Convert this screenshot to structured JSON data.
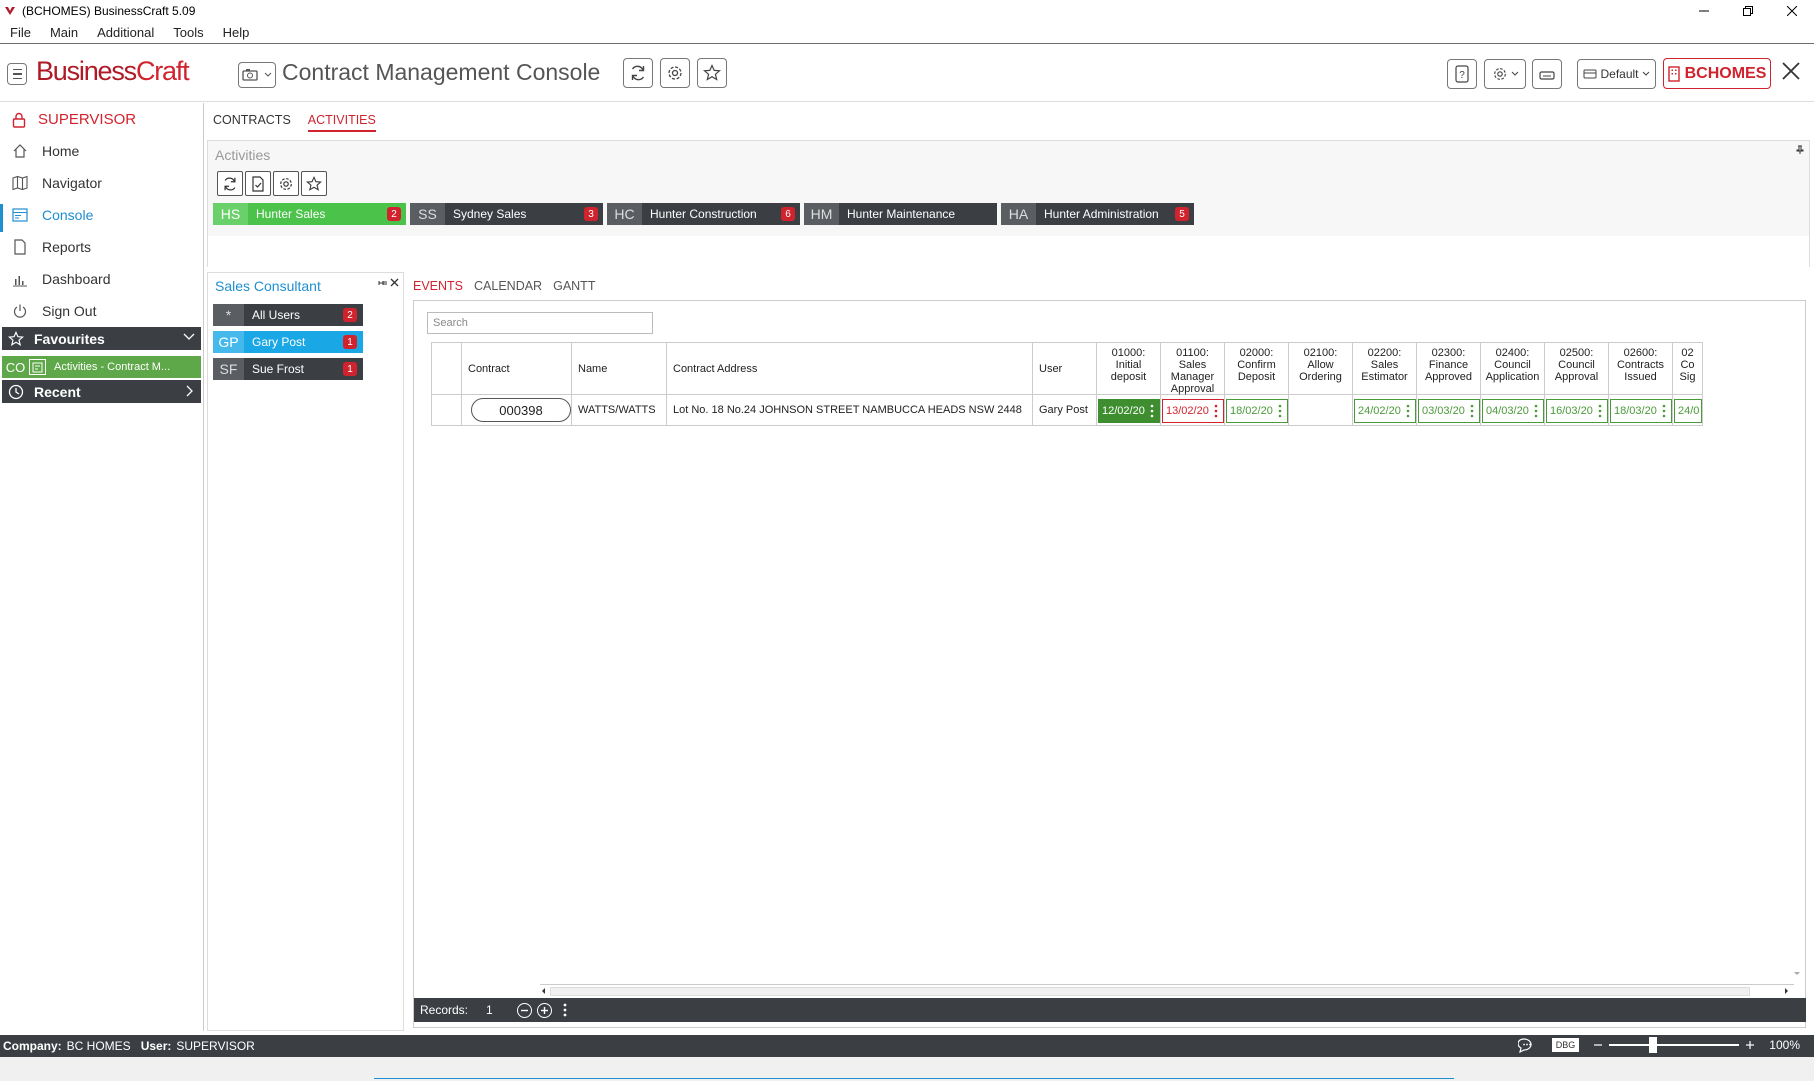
{
  "window": {
    "title": "(BCHOMES) BusinessCraft  5.09"
  },
  "menu": [
    "File",
    "Main",
    "Additional",
    "Tools",
    "Help"
  ],
  "header": {
    "brand_a": "Business",
    "brand_b": "Craft",
    "console_title": "Contract Management Console",
    "profile_label": "Default",
    "company_button": "BCHOMES"
  },
  "sidebar": {
    "user": "SUPERVISOR",
    "items": [
      {
        "label": "Home",
        "icon": "home-icon"
      },
      {
        "label": "Navigator",
        "icon": "map-icon"
      },
      {
        "label": "Console",
        "icon": "console-icon"
      },
      {
        "label": "Reports",
        "icon": "document-icon"
      },
      {
        "label": "Dashboard",
        "icon": "chart-icon"
      },
      {
        "label": "Sign Out",
        "icon": "power-icon"
      }
    ],
    "favourites_label": "Favourites",
    "favourite_item": {
      "code": "CO",
      "label": "Activities - Contract M..."
    },
    "recent_label": "Recent"
  },
  "main_tabs": [
    "CONTRACTS",
    "ACTIVITIES"
  ],
  "activities": {
    "title": "Activities",
    "teams": [
      {
        "code": "HS",
        "name": "Hunter Sales",
        "count": "2"
      },
      {
        "code": "SS",
        "name": "Sydney Sales",
        "count": "3"
      },
      {
        "code": "HC",
        "name": "Hunter Construction",
        "count": "6"
      },
      {
        "code": "HM",
        "name": "Hunter Maintenance",
        "count": ""
      },
      {
        "code": "HA",
        "name": "Hunter Administration",
        "count": "5"
      }
    ]
  },
  "sales_consultant": {
    "title": "Sales Consultant",
    "users": [
      {
        "code": "*",
        "name": "All Users",
        "count": "2"
      },
      {
        "code": "GP",
        "name": "Gary Post",
        "count": "1"
      },
      {
        "code": "SF",
        "name": "Sue Frost",
        "count": "1"
      }
    ]
  },
  "event_tabs": [
    "EVENTS",
    "CALENDAR",
    "GANTT"
  ],
  "grid": {
    "search_placeholder": "Search",
    "columns": {
      "contract": "Contract",
      "name": "Name",
      "address": "Contract Address",
      "user": "User"
    },
    "activity_columns": [
      "01000:\nInitial\ndeposit",
      "01100:\nSales\nManager\nApproval",
      "02000:\nConfirm\nDeposit",
      "02100:\nAllow\nOrdering",
      "02200:\nSales\nEstimator",
      "02300:\nFinance\nApproved",
      "02400:\nCouncil\nApplication",
      "02500:\nCouncil\nApproval",
      "02600:\nContracts\nIssued",
      "02\nCo\nSig"
    ],
    "row": {
      "contract": "000398",
      "name": "WATTS/WATTS",
      "address": "Lot No. 18 No.24 JOHNSON STREET NAMBUCCA HEADS NSW 2448",
      "user": "Gary Post",
      "dates": [
        "12/02/20",
        "13/02/20",
        "18/02/20",
        "",
        "24/02/20",
        "03/03/20",
        "04/03/20",
        "16/03/20",
        "18/03/20",
        "24/0"
      ]
    },
    "records_label": "Records:",
    "records_count": "1"
  },
  "status": {
    "company_label": "Company:",
    "company": "BC HOMES",
    "user_label": "User:",
    "user": "SUPERVISOR",
    "debug_label": "DBG",
    "zoom": "100%"
  },
  "colors": {
    "brand": "#d1232e",
    "accent": "#1e8fcf",
    "green": "#4bc34b",
    "dark": "#3b3f44"
  }
}
